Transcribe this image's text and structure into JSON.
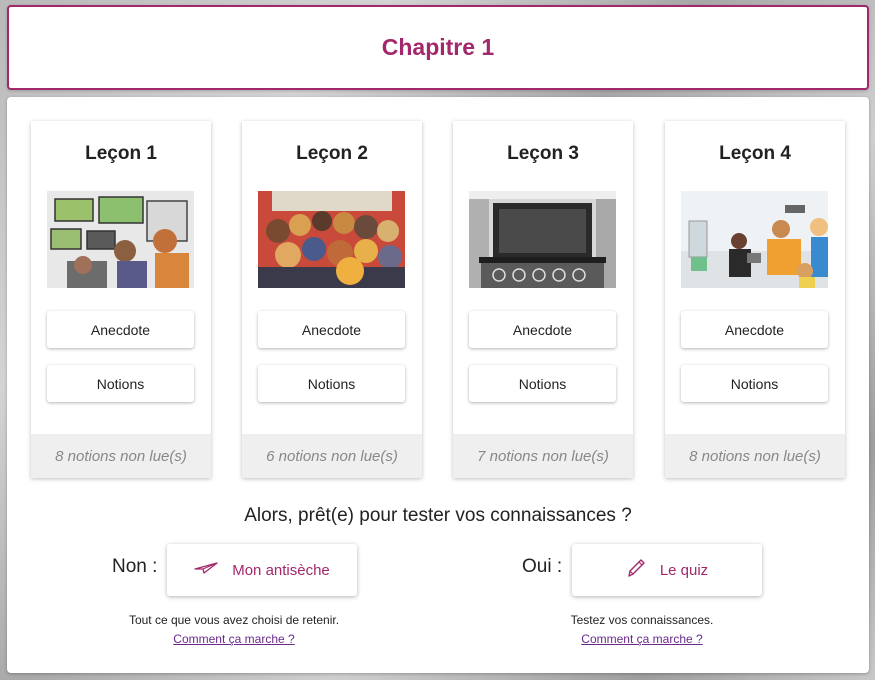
{
  "chapter": {
    "title": "Chapitre 1"
  },
  "lessons": [
    {
      "title": "Leçon 1",
      "anecdote_label": "Anecdote",
      "notions_label": "Notions",
      "footer": "8 notions non lue(s)"
    },
    {
      "title": "Leçon 2",
      "anecdote_label": "Anecdote",
      "notions_label": "Notions",
      "footer": "6 notions non lue(s)"
    },
    {
      "title": "Leçon 3",
      "anecdote_label": "Anecdote",
      "notions_label": "Notions",
      "footer": "7 notions non lue(s)"
    },
    {
      "title": "Leçon 4",
      "anecdote_label": "Anecdote",
      "notions_label": "Notions",
      "footer": "8 notions non lue(s)"
    }
  ],
  "quiz_prompt": "Alors, prêt(e) pour tester vos connaissances ?",
  "no_choice": {
    "label": "Non :",
    "button": "Mon antisèche",
    "icon": "paper-plane-icon",
    "description": "Tout ce que vous avez choisi de retenir.",
    "link": "Comment ça marche ?"
  },
  "yes_choice": {
    "label": "Oui :",
    "button": "Le quiz",
    "icon": "pencil-icon",
    "description": "Testez vos connaissances.",
    "link": "Comment ça marche ?"
  },
  "colors": {
    "accent": "#a3286b",
    "link": "#6a2a8a"
  }
}
